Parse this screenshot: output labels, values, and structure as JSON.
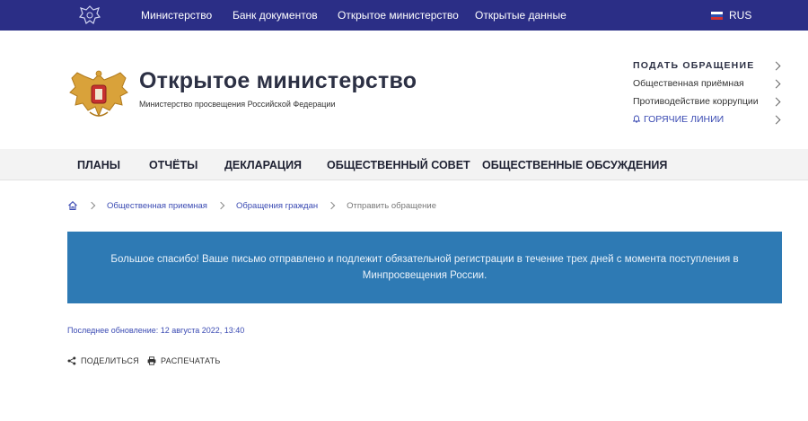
{
  "topbar": {
    "nav": [
      "Министерство",
      "Банк документов",
      "Открытое министерство",
      "Открытые данные"
    ],
    "lang": "RUS"
  },
  "header": {
    "title": "Открытое министерство",
    "subtitle": "Министерство просвещения Российской Федерации",
    "side_links": {
      "submit": "ПОДАТЬ ОБРАЩЕНИЕ",
      "reception": "Общественная приёмная",
      "anticorruption": "Противодействие коррупции",
      "hotlines": "ГОРЯЧИЕ ЛИНИИ"
    }
  },
  "mainnav": [
    "ПЛАНЫ",
    "ОТЧЁТЫ",
    "ДЕКЛАРАЦИЯ",
    "ОБЩЕСТВЕННЫЙ СОВЕТ",
    "ОБЩЕСТВЕННЫЕ ОБСУЖДЕНИЯ"
  ],
  "breadcrumb": {
    "items": [
      "Общественная приемная",
      "Обращения граждан"
    ],
    "current": "Отправить обращение"
  },
  "alert": {
    "message": "Большое спасибо! Ваше письмо отправлено и подлежит обязательной регистрации в течение трех дней с момента поступления в Минпросвещения России."
  },
  "updated": "Последнее обновление: 12 августа 2022, 13:40",
  "actions": {
    "share": "ПОДЕЛИТЬСЯ",
    "print": "РАСПЕЧАТАТЬ"
  },
  "colors": {
    "topbar": "#2b2e86",
    "accent_link": "#3b4bb3",
    "alert_bg": "#2e7ab4",
    "nav_bg": "#f3f3f3"
  }
}
